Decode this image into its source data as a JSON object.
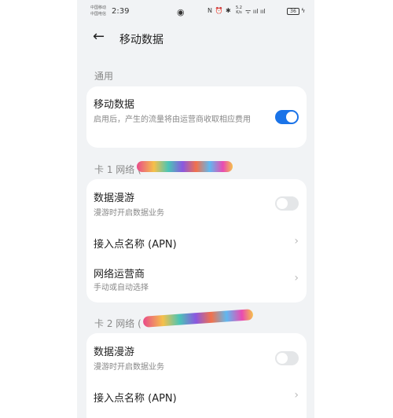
{
  "status_bar": {
    "carrier_line1": "中国移动",
    "carrier_line2": "中国电信",
    "time": "2:39",
    "eye_icon": "eye-icon",
    "sys_icons": "N ⏰ ✱",
    "speed_value": "5.2",
    "speed_unit": "K/s",
    "signal": "ᯤ ııl ııl",
    "battery": "36",
    "charging_icon": "bolt-icon"
  },
  "header": {
    "back_icon": "arrow-left-icon",
    "title": "移动数据"
  },
  "general": {
    "section_label": "通用",
    "mobile_data": {
      "title": "移动数据",
      "subtitle": "启用后，产生的流量将由运营商收取相应费用",
      "enabled": true
    }
  },
  "sim1": {
    "section_label": "卡 1 网络 (",
    "roaming": {
      "title": "数据漫游",
      "subtitle": "漫游时开启数据业务",
      "enabled": false
    },
    "apn": {
      "title": "接入点名称 (APN)"
    },
    "carrier": {
      "title": "网络运营商",
      "subtitle": "手动或自动选择"
    }
  },
  "sim2": {
    "section_label": "卡 2 网络 (",
    "roaming": {
      "title": "数据漫游",
      "subtitle": "漫游时开启数据业务",
      "enabled": false
    },
    "apn": {
      "title": "接入点名称 (APN)"
    }
  },
  "colors": {
    "accent": "#1a73e8",
    "background": "#f1f3f5",
    "card": "#ffffff"
  }
}
